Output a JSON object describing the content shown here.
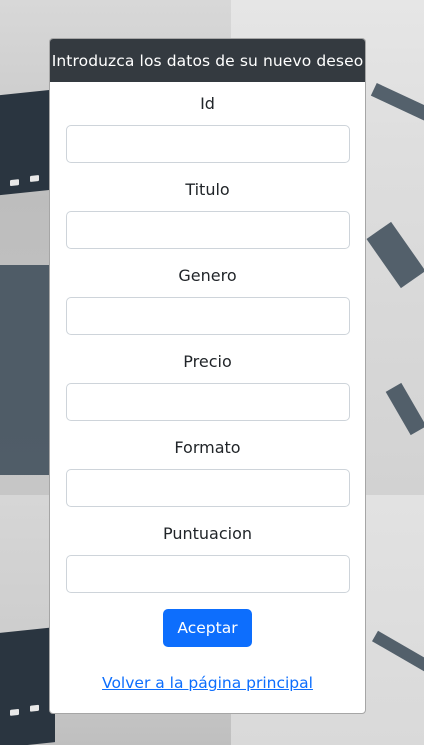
{
  "form": {
    "title": "Introduzca los datos de su nuevo deseo",
    "fields": [
      {
        "label": "Id",
        "value": ""
      },
      {
        "label": "Titulo",
        "value": ""
      },
      {
        "label": "Genero",
        "value": ""
      },
      {
        "label": "Precio",
        "value": ""
      },
      {
        "label": "Formato",
        "value": ""
      },
      {
        "label": "Puntuacion",
        "value": ""
      }
    ],
    "submit_label": "Aceptar",
    "back_link_label": "Volver a la página principal"
  },
  "colors": {
    "header_bg": "#343a40",
    "primary": "#0d6efd"
  }
}
